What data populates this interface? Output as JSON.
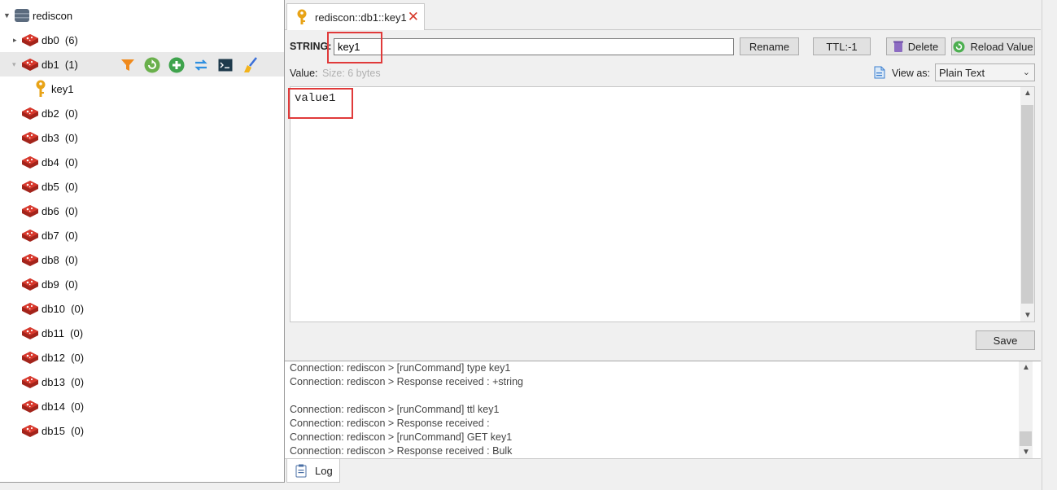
{
  "tree": {
    "connection": {
      "label": "rediscon"
    },
    "databases": [
      {
        "name": "db0",
        "count": "(6)"
      },
      {
        "name": "db1",
        "count": "(1)"
      },
      {
        "name": "db2",
        "count": "(0)"
      },
      {
        "name": "db3",
        "count": "(0)"
      },
      {
        "name": "db4",
        "count": "(0)"
      },
      {
        "name": "db5",
        "count": "(0)"
      },
      {
        "name": "db6",
        "count": "(0)"
      },
      {
        "name": "db7",
        "count": "(0)"
      },
      {
        "name": "db8",
        "count": "(0)"
      },
      {
        "name": "db9",
        "count": "(0)"
      },
      {
        "name": "db10",
        "count": "(0)"
      },
      {
        "name": "db11",
        "count": "(0)"
      },
      {
        "name": "db12",
        "count": "(0)"
      },
      {
        "name": "db13",
        "count": "(0)"
      },
      {
        "name": "db14",
        "count": "(0)"
      },
      {
        "name": "db15",
        "count": "(0)"
      }
    ],
    "key": {
      "label": "key1"
    }
  },
  "tab": {
    "label": "rediscon::db1::key1"
  },
  "editor": {
    "type_label": "STRING:",
    "key_value": "key1",
    "rename_label": "Rename",
    "ttl_label": "TTL:-1",
    "delete_label": "Delete",
    "reload_label": "Reload Value",
    "value_label": "Value:",
    "size_hint": "Size: 6 bytes",
    "view_as_label": "View as:",
    "view_as_selected": "Plain Text",
    "value_text": "value1",
    "save_label": "Save"
  },
  "log": {
    "lines": [
      "Connection: rediscon > [runCommand] type key1",
      "Connection: rediscon > Response received : +string",
      "",
      "Connection: rediscon > [runCommand] ttl key1",
      "Connection: rediscon > Response received :",
      "Connection: rediscon > [runCommand] GET key1",
      "Connection: rediscon > Response received : Bulk"
    ],
    "tab_label": "Log"
  },
  "colors": {
    "highlight": "#e03a3a",
    "redis_red": "#c8281e",
    "key_gold": "#e8a317"
  }
}
